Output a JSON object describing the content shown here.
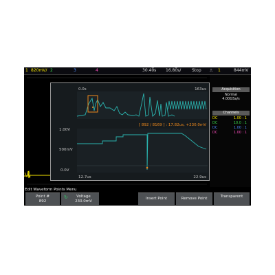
{
  "topbar": {
    "ch1": "1",
    "ch1_scale": "820mV/",
    "ch2": "2",
    "ch3": "3",
    "ch4": "4",
    "delay": "30.40̅s",
    "timebase": "16.80̅s/",
    "run_state": "Stop",
    "trig_ch": "1",
    "trig_level": "844mV"
  },
  "dialog": {
    "overview_start": "0.0s",
    "overview_end": "163us",
    "point_readout": "[ 892 / 8169 ] : 17.82us, +230.0mV",
    "y_max": "1.00V",
    "y_mid": "500mV",
    "y_min": "0.0V",
    "x_start": "12.7us",
    "x_end": "22.9us"
  },
  "acquisition": {
    "header": "Acquisition",
    "mode": "Normal",
    "rate": "4.00GSa/s"
  },
  "channels": {
    "header": "Channels",
    "items": [
      {
        "coupling": "DC",
        "ratio": "1.00 : 1",
        "color": "#f5e400"
      },
      {
        "coupling": "DC",
        "ratio": "10.0 : 1",
        "color": "#39d84a"
      },
      {
        "coupling": "DC",
        "ratio": "1.00 : 1",
        "color": "#4d8cff"
      },
      {
        "coupling": "DC",
        "ratio": "1.00 : 1",
        "color": "#ff4fc0"
      }
    ]
  },
  "menu": {
    "title": "Edit Waveform Points Menu",
    "point_label": "Point #",
    "point_value": "892",
    "voltage_label": "Voltage",
    "voltage_value": "230.0mV",
    "insert_label": "Insert Point",
    "remove_label": "Remove Point",
    "transparent_label": "Transparent"
  },
  "colors": {
    "trace": "#2bb5b0",
    "highlight": "#f08a1c",
    "ch1": "#f5e400",
    "ch2": "#39d84a",
    "ch3": "#4d8cff",
    "ch4": "#ff4fc0"
  }
}
